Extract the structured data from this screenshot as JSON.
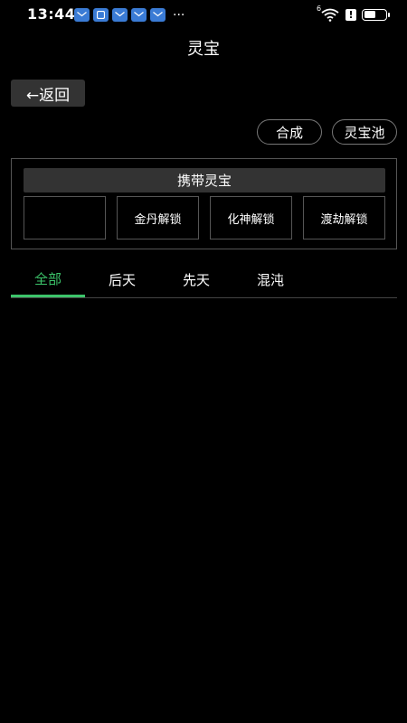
{
  "status_bar": {
    "time": "13:44",
    "more": "···",
    "network_label": "6",
    "alert": "!",
    "battery_level": 0.55,
    "notification_icons": [
      "mail-icon",
      "app-icon",
      "mail-icon",
      "mail-icon",
      "mail-icon"
    ]
  },
  "header": {
    "title": "灵宝"
  },
  "back_button": {
    "label": "←返回"
  },
  "actions": {
    "merge": "合成",
    "pool": "灵宝池"
  },
  "carry": {
    "title": "携带灵宝",
    "slots": [
      "",
      "金丹解锁",
      "化神解锁",
      "渡劫解锁"
    ]
  },
  "tabs": [
    {
      "label": "全部",
      "active": true
    },
    {
      "label": "后天",
      "active": false
    },
    {
      "label": "先天",
      "active": false
    },
    {
      "label": "混沌",
      "active": false
    }
  ],
  "colors": {
    "accent": "#3cc46a",
    "background": "#000000",
    "panel": "#333333"
  }
}
